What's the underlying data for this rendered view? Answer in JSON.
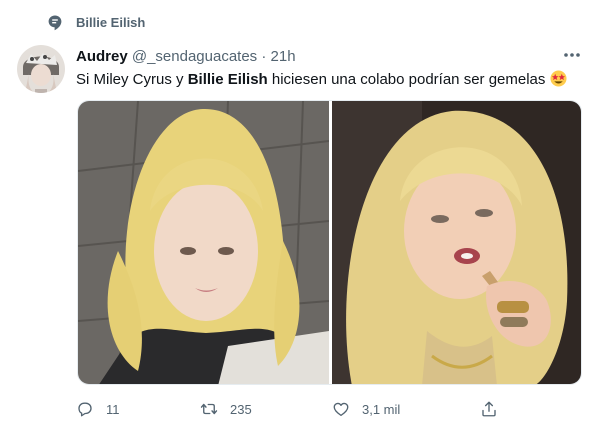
{
  "topic": {
    "label": "Billie Eilish"
  },
  "tweet": {
    "author_name": "Audrey",
    "author_handle": "@_sendaguacates",
    "separator": "·",
    "time": "21h",
    "text_part1": "Si Miley Cyrus y ",
    "text_bold": "Billie Eilish",
    "text_part2": " hiciesen  una colabo podrían ser gemelas",
    "emoji": "star-struck-emoji"
  },
  "actions": {
    "replies": "11",
    "retweets": "235",
    "likes": "3,1 mil"
  },
  "icons": {
    "topic": "topic-bubble-icon",
    "more": "more-horizontal-icon",
    "reply": "reply-icon",
    "retweet": "retweet-icon",
    "like": "heart-icon",
    "share": "share-icon"
  },
  "colors": {
    "text_primary": "#0f1419",
    "text_secondary": "#536471",
    "photo_hair": "#e8d37a",
    "photo_bg_left": "#6d6a66",
    "photo_bg_right": "#2e2622"
  }
}
